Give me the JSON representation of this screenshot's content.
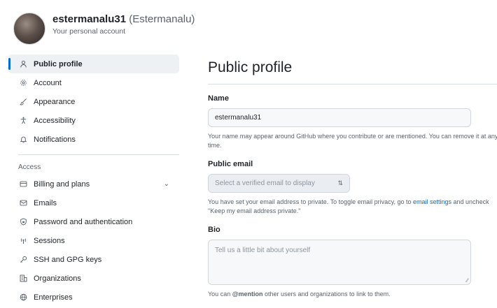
{
  "account": {
    "username": "estermanalu31",
    "fullname": "(Estermanalu)",
    "subtitle": "Your personal account"
  },
  "sidebar": {
    "items": [
      {
        "label": "Public profile",
        "icon": "person-icon"
      },
      {
        "label": "Account",
        "icon": "gear-icon"
      },
      {
        "label": "Appearance",
        "icon": "paintbrush-icon"
      },
      {
        "label": "Accessibility",
        "icon": "accessibility-icon"
      },
      {
        "label": "Notifications",
        "icon": "bell-icon"
      }
    ],
    "access_label": "Access",
    "access_items": [
      {
        "label": "Billing and plans",
        "icon": "credit-card-icon"
      },
      {
        "label": "Emails",
        "icon": "mail-icon"
      },
      {
        "label": "Password and authentication",
        "icon": "shield-lock-icon"
      },
      {
        "label": "Sessions",
        "icon": "broadcast-icon"
      },
      {
        "label": "SSH and GPG keys",
        "icon": "key-icon"
      },
      {
        "label": "Organizations",
        "icon": "organization-icon"
      },
      {
        "label": "Enterprises",
        "icon": "globe-icon"
      }
    ]
  },
  "main": {
    "title": "Public profile",
    "name": {
      "label": "Name",
      "value": "estermanalu31",
      "help": "Your name may appear around GitHub where you contribute or are mentioned. You can remove it at any time."
    },
    "public_email": {
      "label": "Public email",
      "selected": "Select a verified email to display",
      "help_before": "You have set your email address to private. To toggle email privacy, go to ",
      "help_link": "email settings",
      "help_after": " and uncheck \"Keep my email address private.\""
    },
    "bio": {
      "label": "Bio",
      "placeholder": "Tell us a little bit about yourself",
      "help_before": "You can ",
      "help_mention": "@mention",
      "help_after": " other users and organizations to link to them."
    }
  },
  "colors": {
    "accent": "#0969da",
    "active_bg": "#eef1f4",
    "border": "#d0d7de",
    "muted_text": "#59636e"
  }
}
